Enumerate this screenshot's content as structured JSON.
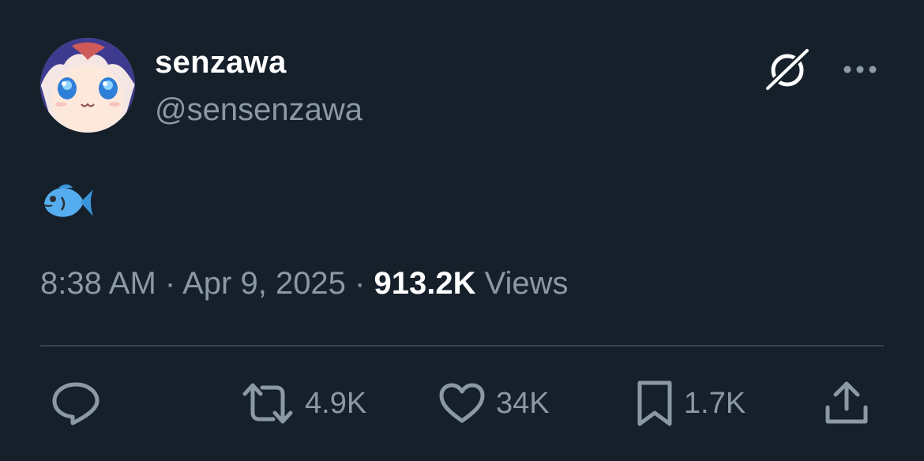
{
  "tweet": {
    "author": {
      "display_name": "senzawa",
      "handle": "@sensenzawa"
    },
    "body_emoji": "fish-emoji",
    "meta": {
      "time": "8:38 AM",
      "sep1": " · ",
      "date": "Apr 9, 2025",
      "sep2": " · ",
      "views_count": "913.2K",
      "views_label": " Views"
    },
    "actions": {
      "reply_count": "",
      "retweet_count": "4.9K",
      "like_count": "34K",
      "bookmark_count": "1.7K"
    }
  },
  "colors": {
    "background": "#15202b",
    "primary_text": "#ffffff",
    "secondary_text": "#8b98a5",
    "divider": "#38444d",
    "fish": "#55acee"
  },
  "icons": {
    "grok": "grok-icon",
    "more": "more-dots-icon",
    "reply": "reply-icon",
    "retweet": "retweet-icon",
    "like": "heart-icon",
    "bookmark": "bookmark-icon",
    "share": "share-icon"
  }
}
